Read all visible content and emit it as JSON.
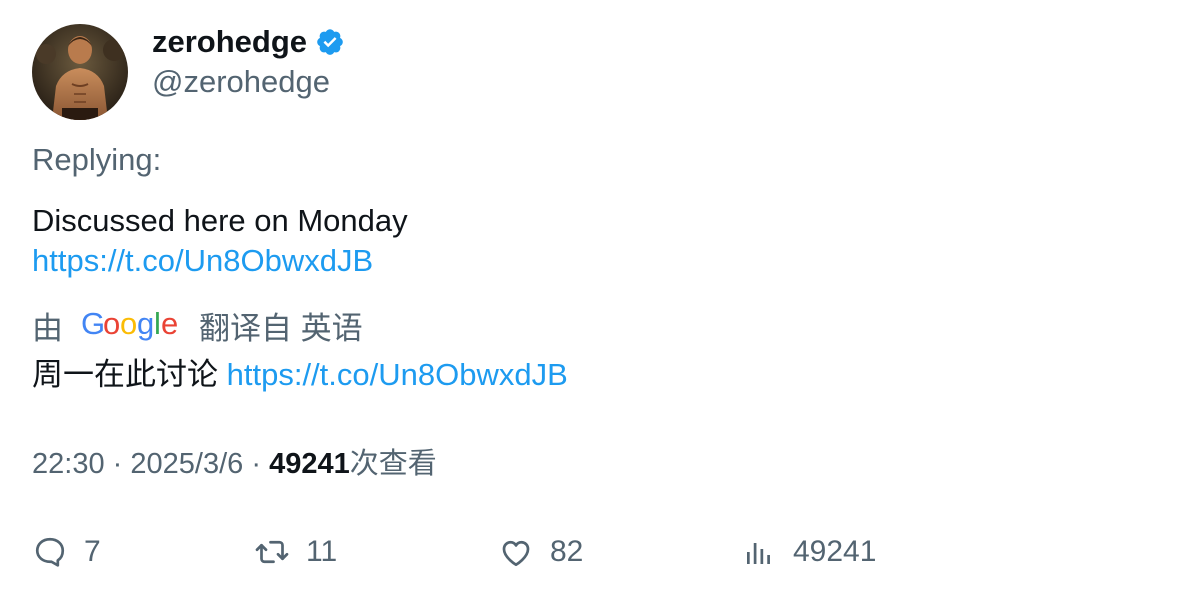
{
  "author": {
    "display_name": "zerohedge",
    "handle": "@zerohedge",
    "verified": true
  },
  "replying_label": "Replying:",
  "tweet": {
    "text": "Discussed here on Monday",
    "link": "https://t.co/Un8ObwxdJB"
  },
  "translation": {
    "prefix": "由",
    "provider_logo": "Google",
    "suffix": "翻译自 英语",
    "text": "周一在此讨论",
    "link": "https://t.co/Un8ObwxdJB"
  },
  "meta": {
    "time": "22:30",
    "separator": "·",
    "date": "2025/3/6",
    "views_count": "49241",
    "views_label": "次查看"
  },
  "actions": {
    "replies": "7",
    "retweets": "11",
    "likes": "82",
    "views": "49241"
  },
  "colors": {
    "link": "#1d9bf0",
    "verified": "#1d9bf0",
    "secondary_text": "#536471",
    "primary_text": "#0f1419"
  },
  "icons": {
    "reply": "reply-icon",
    "retweet": "retweet-icon",
    "like": "heart-icon",
    "views": "views-chart-icon",
    "verified": "verified-badge-icon"
  }
}
